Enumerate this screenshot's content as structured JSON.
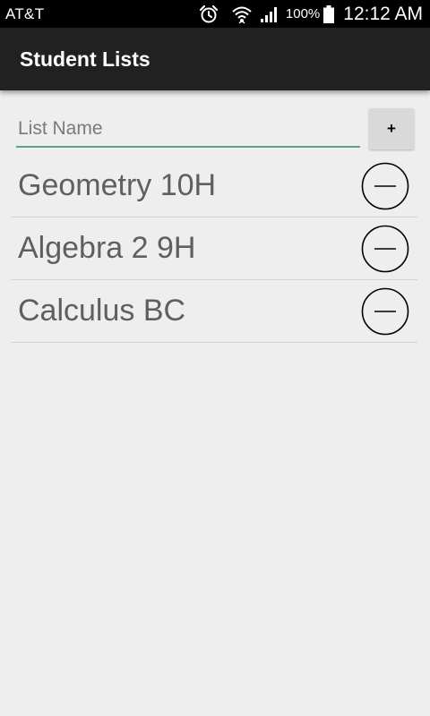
{
  "status_bar": {
    "carrier": "AT&T",
    "battery_percent": "100%",
    "time": "12:12 AM",
    "icons": [
      "alarm-clock-icon",
      "wifi-icon",
      "signal-icon",
      "battery-icon"
    ]
  },
  "action_bar": {
    "title": "Student Lists",
    "background": "#212121"
  },
  "new_list": {
    "placeholder": "List Name",
    "value": "",
    "add_label": "+",
    "underline_color": "#5e9e97"
  },
  "lists": [
    {
      "name": "Geometry 10H",
      "remove_icon": "minus-circle-icon"
    },
    {
      "name": "Algebra 2 9H",
      "remove_icon": "minus-circle-icon"
    },
    {
      "name": "Calculus BC",
      "remove_icon": "minus-circle-icon"
    }
  ]
}
